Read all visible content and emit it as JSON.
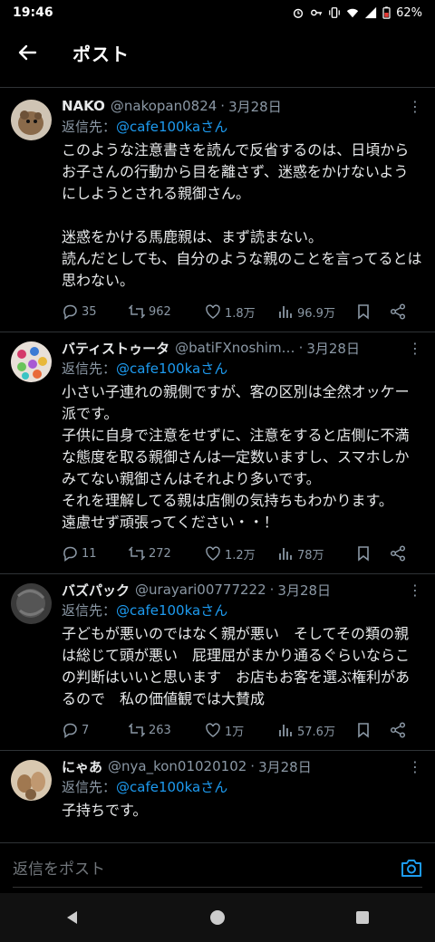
{
  "status": {
    "time": "19:46",
    "battery": "62%"
  },
  "header": {
    "title": "ポスト"
  },
  "tweets": [
    {
      "name": "NAKO",
      "handle": "@nakopan0824",
      "date": "3月28日",
      "reply_label": "返信先：",
      "reply_to": "@cafe100kaさん",
      "text": "このような注意書きを読んで反省するのは、日頃からお子さんの行動から目を離さず、迷惑をかけないようにしようとされる親御さん。\n\n迷惑をかける馬鹿親は、まず読まない。\n読んだとしても、自分のような親のことを言ってるとは思わない。",
      "replies": "35",
      "reposts": "962",
      "likes": "1.8万",
      "views": "96.9万"
    },
    {
      "name": "バティストゥータ",
      "handle": "@batiFXnoshim…",
      "date": "3月28日",
      "reply_label": "返信先：",
      "reply_to": "@cafe100kaさん",
      "text": "小さい子連れの親側ですが、客の区別は全然オッケー派です。\n子供に自身で注意をせずに、注意をすると店側に不満な態度を取る親御さんは一定数いますし、スマホしかみてない親御さんはそれより多いです。\nそれを理解してる親は店側の気持ちもわかります。\n遠慮せず頑張ってください・・！",
      "replies": "11",
      "reposts": "272",
      "likes": "1.2万",
      "views": "78万"
    },
    {
      "name": "バズパック",
      "handle": "@urayari00777222",
      "date": "3月28日",
      "reply_label": "返信先：",
      "reply_to": "@cafe100kaさん",
      "text": "子どもが悪いのではなく親が悪い　そしてその類の親は総じて頭が悪い　屁理屈がまかり通るぐらいならこの判断はいいと思います　お店もお客を選ぶ権利があるので　私の価値観では大賛成",
      "replies": "7",
      "reposts": "263",
      "likes": "1万",
      "views": "57.6万"
    },
    {
      "name": "にゃあ",
      "handle": "@nya_kon01020102",
      "date": "3月28日",
      "reply_label": "返信先：",
      "reply_to": "@cafe100kaさん",
      "text": "子持ちです。"
    }
  ],
  "reply_bar": {
    "placeholder": "返信をポスト"
  },
  "colors": {
    "link": "#1d9bf0",
    "muted": "#8b98a5",
    "text": "#e7e9ea",
    "background": "#000000"
  },
  "icons": {
    "header": "back-arrow-icon",
    "actions": [
      "reply-icon",
      "repost-icon",
      "like-icon",
      "views-icon",
      "bookmark-icon",
      "share-icon"
    ],
    "navbar": [
      "back-triangle-icon",
      "home-circle-icon",
      "recents-square-icon"
    ]
  }
}
